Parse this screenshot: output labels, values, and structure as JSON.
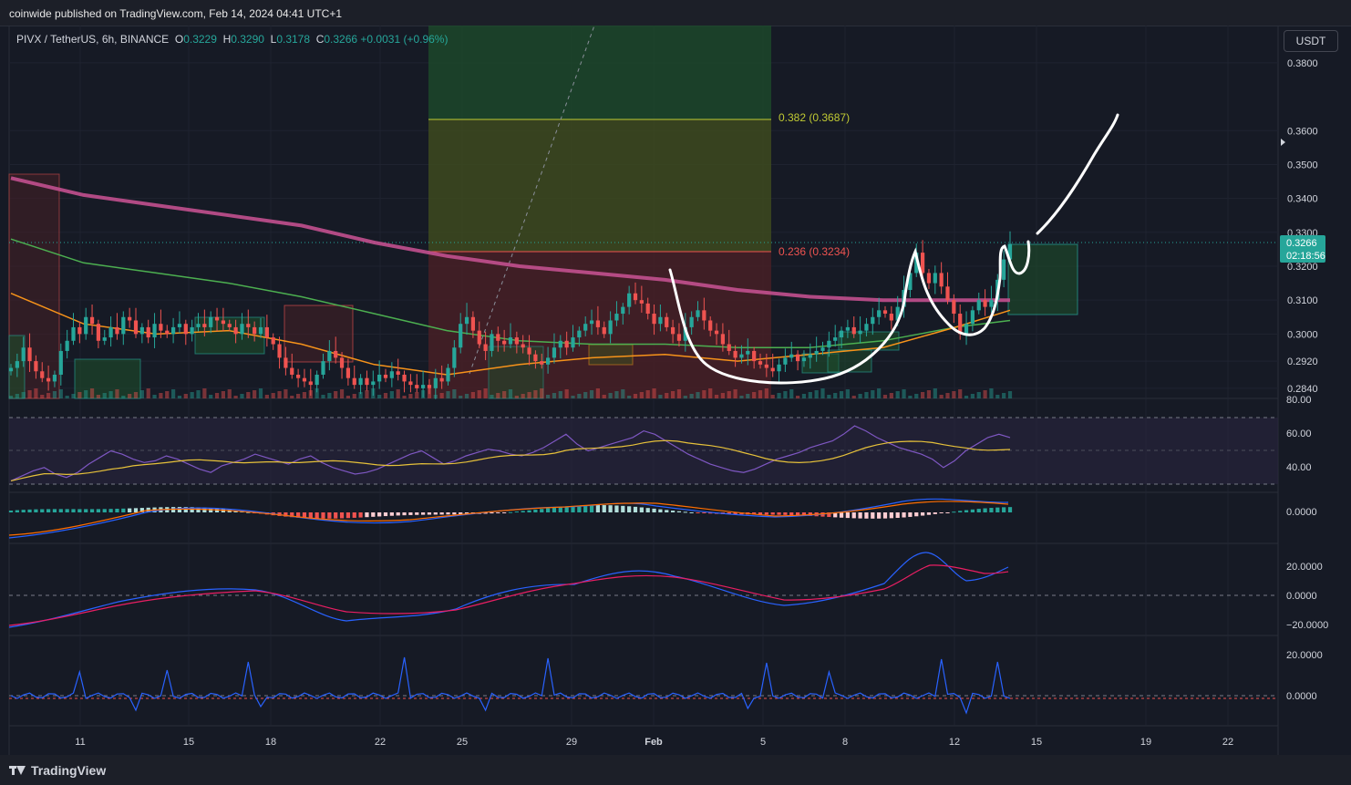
{
  "header": {
    "published": "coinwide published on TradingView.com, Feb 14, 2024 04:41 UTC+1"
  },
  "legend": {
    "symbol": "PIVX / TetherUS, 6h, BINANCE",
    "o_label": "O",
    "o": "0.3229",
    "h_label": "H",
    "h": "0.3290",
    "l_label": "L",
    "l": "0.3178",
    "c_label": "C",
    "c": "0.3266",
    "change": "+0.0031 (+0.96%)"
  },
  "currency_button": "USDT",
  "colors": {
    "up": "#26a69a",
    "down": "#ef5350",
    "ma200": "#c2508f",
    "ma100": "#4caf50",
    "ma50": "#f7931a",
    "rsi": "#7e57c2",
    "fib_382": "#c0ca33",
    "fib_236": "#ef5350"
  },
  "price_axis": {
    "ticks": [
      {
        "value": 0.38,
        "label": "0.3800"
      },
      {
        "value": 0.36,
        "label": "0.3600"
      },
      {
        "value": 0.35,
        "label": "0.3500"
      },
      {
        "value": 0.34,
        "label": "0.3400"
      },
      {
        "value": 0.33,
        "label": "0.3300"
      },
      {
        "value": 0.32,
        "label": "0.3200"
      },
      {
        "value": 0.31,
        "label": "0.3100"
      },
      {
        "value": 0.3,
        "label": "0.3000"
      },
      {
        "value": 0.292,
        "label": "0.2920"
      },
      {
        "value": 0.284,
        "label": "0.2840"
      }
    ],
    "last_price": "0.3266",
    "countdown": "02:18:56"
  },
  "fib": {
    "level_382": "0.382 (0.3687)",
    "level_236": "0.236 (0.3234)"
  },
  "rsi_axis": [
    "80.00",
    "60.00",
    "40.00"
  ],
  "macd_axis": [
    "0.0000"
  ],
  "osc_axis": [
    "20.0000",
    "0.0000",
    "−20.0000"
  ],
  "osc2_axis": [
    "20.0000",
    "0.0000"
  ],
  "time_axis": [
    "11",
    "15",
    "18",
    "22",
    "25",
    "29",
    "Feb",
    "5",
    "8",
    "12",
    "15",
    "19",
    "22"
  ],
  "footer": {
    "brand": "TradingView"
  },
  "chart_data": {
    "type": "candlestick",
    "symbol": "PIVX / TetherUS",
    "interval": "6h",
    "ylim": [
      0.281,
      0.391
    ],
    "ma200": [
      [
        0,
        0.346
      ],
      [
        12,
        0.341
      ],
      [
        24,
        0.338
      ],
      [
        36,
        0.335
      ],
      [
        48,
        0.332
      ],
      [
        60,
        0.327
      ],
      [
        72,
        0.323
      ],
      [
        84,
        0.32
      ],
      [
        96,
        0.318
      ],
      [
        108,
        0.316
      ],
      [
        120,
        0.313
      ],
      [
        132,
        0.311
      ],
      [
        144,
        0.31
      ],
      [
        156,
        0.31
      ],
      [
        165,
        0.31
      ]
    ],
    "ma100": [
      [
        0,
        0.328
      ],
      [
        12,
        0.321
      ],
      [
        24,
        0.318
      ],
      [
        36,
        0.315
      ],
      [
        48,
        0.311
      ],
      [
        60,
        0.306
      ],
      [
        72,
        0.301
      ],
      [
        84,
        0.298
      ],
      [
        96,
        0.297
      ],
      [
        108,
        0.297
      ],
      [
        120,
        0.296
      ],
      [
        132,
        0.296
      ],
      [
        144,
        0.298
      ],
      [
        156,
        0.302
      ],
      [
        165,
        0.304
      ]
    ],
    "ma50": [
      [
        0,
        0.312
      ],
      [
        12,
        0.303
      ],
      [
        24,
        0.3
      ],
      [
        36,
        0.301
      ],
      [
        48,
        0.297
      ],
      [
        60,
        0.291
      ],
      [
        72,
        0.288
      ],
      [
        84,
        0.291
      ],
      [
        96,
        0.293
      ],
      [
        108,
        0.294
      ],
      [
        120,
        0.292
      ],
      [
        132,
        0.294
      ],
      [
        144,
        0.296
      ],
      [
        156,
        0.302
      ],
      [
        165,
        0.307
      ]
    ],
    "closes": [
      0.29,
      0.292,
      0.296,
      0.292,
      0.289,
      0.287,
      0.286,
      0.288,
      0.295,
      0.298,
      0.302,
      0.3,
      0.305,
      0.303,
      0.298,
      0.299,
      0.302,
      0.3,
      0.305,
      0.304,
      0.3,
      0.302,
      0.299,
      0.303,
      0.301,
      0.3,
      0.302,
      0.303,
      0.3,
      0.302,
      0.303,
      0.302,
      0.305,
      0.304,
      0.303,
      0.302,
      0.3,
      0.303,
      0.302,
      0.3,
      0.302,
      0.299,
      0.297,
      0.293,
      0.29,
      0.288,
      0.287,
      0.286,
      0.285,
      0.288,
      0.292,
      0.295,
      0.293,
      0.29,
      0.287,
      0.285,
      0.287,
      0.285,
      0.286,
      0.288,
      0.287,
      0.289,
      0.288,
      0.286,
      0.285,
      0.284,
      0.285,
      0.284,
      0.287,
      0.286,
      0.29,
      0.296,
      0.303,
      0.305,
      0.301,
      0.297,
      0.295,
      0.3,
      0.298,
      0.297,
      0.299,
      0.297,
      0.296,
      0.294,
      0.292,
      0.291,
      0.293,
      0.296,
      0.298,
      0.296,
      0.299,
      0.301,
      0.303,
      0.304,
      0.302,
      0.3,
      0.304,
      0.306,
      0.308,
      0.312,
      0.31,
      0.309,
      0.306,
      0.303,
      0.305,
      0.302,
      0.3,
      0.298,
      0.302,
      0.305,
      0.307,
      0.304,
      0.301,
      0.3,
      0.297,
      0.295,
      0.293,
      0.294,
      0.295,
      0.292,
      0.291,
      0.29,
      0.289,
      0.291,
      0.293,
      0.294,
      0.292,
      0.293,
      0.294,
      0.295,
      0.296,
      0.298,
      0.299,
      0.301,
      0.302,
      0.3,
      0.301,
      0.303,
      0.305,
      0.307,
      0.306,
      0.304,
      0.308,
      0.313,
      0.318,
      0.324,
      0.318,
      0.315,
      0.318,
      0.314,
      0.31,
      0.306,
      0.3,
      0.303,
      0.307,
      0.31,
      0.308,
      0.31,
      0.316,
      0.322,
      0.3266
    ],
    "rsi": [
      42,
      45,
      48,
      50,
      46,
      44,
      47,
      52,
      56,
      60,
      58,
      55,
      53,
      54,
      57,
      55,
      52,
      49,
      47,
      51,
      53,
      55,
      58,
      56,
      54,
      52,
      55,
      57,
      53,
      50,
      48,
      46,
      47,
      49,
      52,
      55,
      58,
      60,
      56,
      52,
      54,
      57,
      59,
      61,
      60,
      58,
      57,
      59,
      62,
      66,
      70,
      64,
      60,
      62,
      64,
      66,
      68,
      72,
      70,
      66,
      62,
      58,
      55,
      52,
      50,
      48,
      47,
      49,
      52,
      55,
      57,
      59,
      62,
      64,
      66,
      70,
      75,
      72,
      68,
      65,
      62,
      60,
      58,
      55,
      50,
      54,
      60,
      64,
      68,
      70,
      68
    ]
  }
}
